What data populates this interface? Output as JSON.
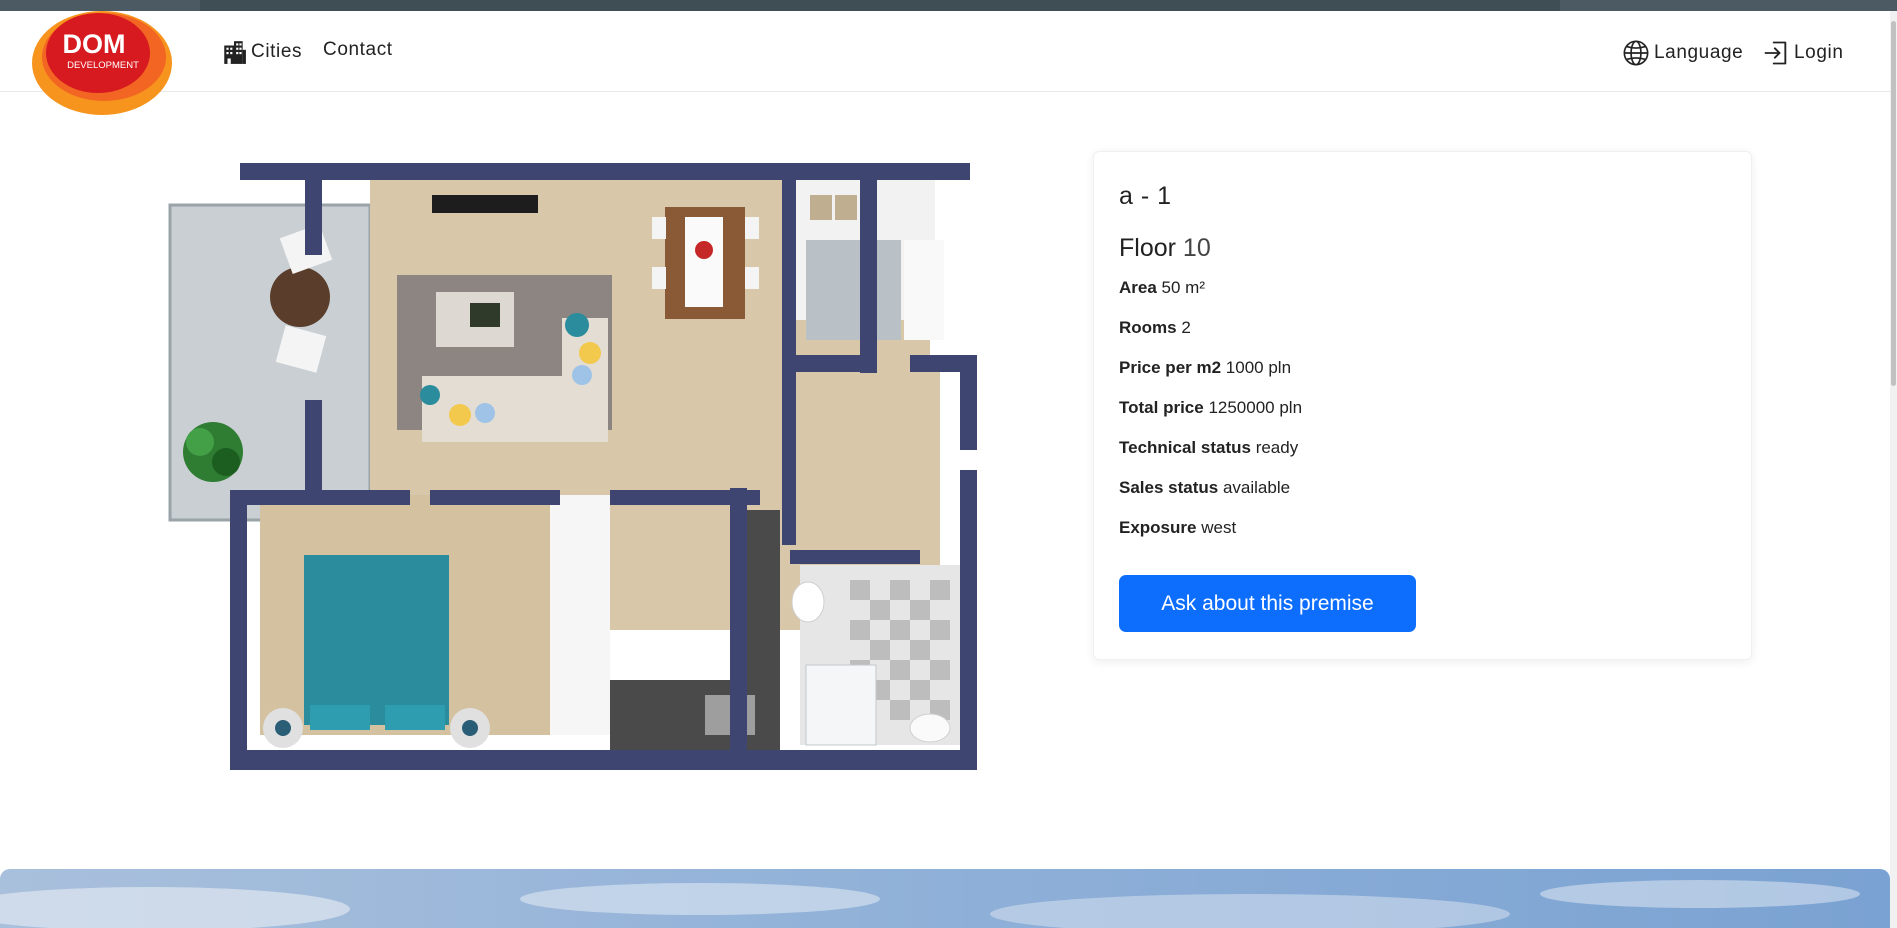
{
  "brand": {
    "logo_line1": "DOM",
    "logo_line2": "DEVELOPMENT"
  },
  "nav": {
    "cities": "Cities",
    "contact": "Contact",
    "language": "Language",
    "login": "Login"
  },
  "icons": {
    "cities": "building-icon",
    "language": "globe-icon",
    "login": "login-arrow-icon"
  },
  "premise": {
    "title": "a - 1",
    "floor_label": "Floor",
    "floor_value": "10",
    "area_label": "Area",
    "area_value": "50 m²",
    "rooms_label": "Rooms",
    "rooms_value": "2",
    "price_m2_label": "Price per m2",
    "price_m2_value": "1000 pln",
    "total_label": "Total price",
    "total_value": "1250000 pln",
    "tech_label": "Technical status",
    "tech_value": "ready",
    "sales_label": "Sales status",
    "sales_value": "available",
    "exposure_label": "Exposure",
    "exposure_value": "west",
    "cta": "Ask about this premise"
  },
  "colors": {
    "primary": "#0d6efd",
    "logo_orange": "#f7941d",
    "logo_red": "#d71920",
    "wall": "#3e4570"
  }
}
